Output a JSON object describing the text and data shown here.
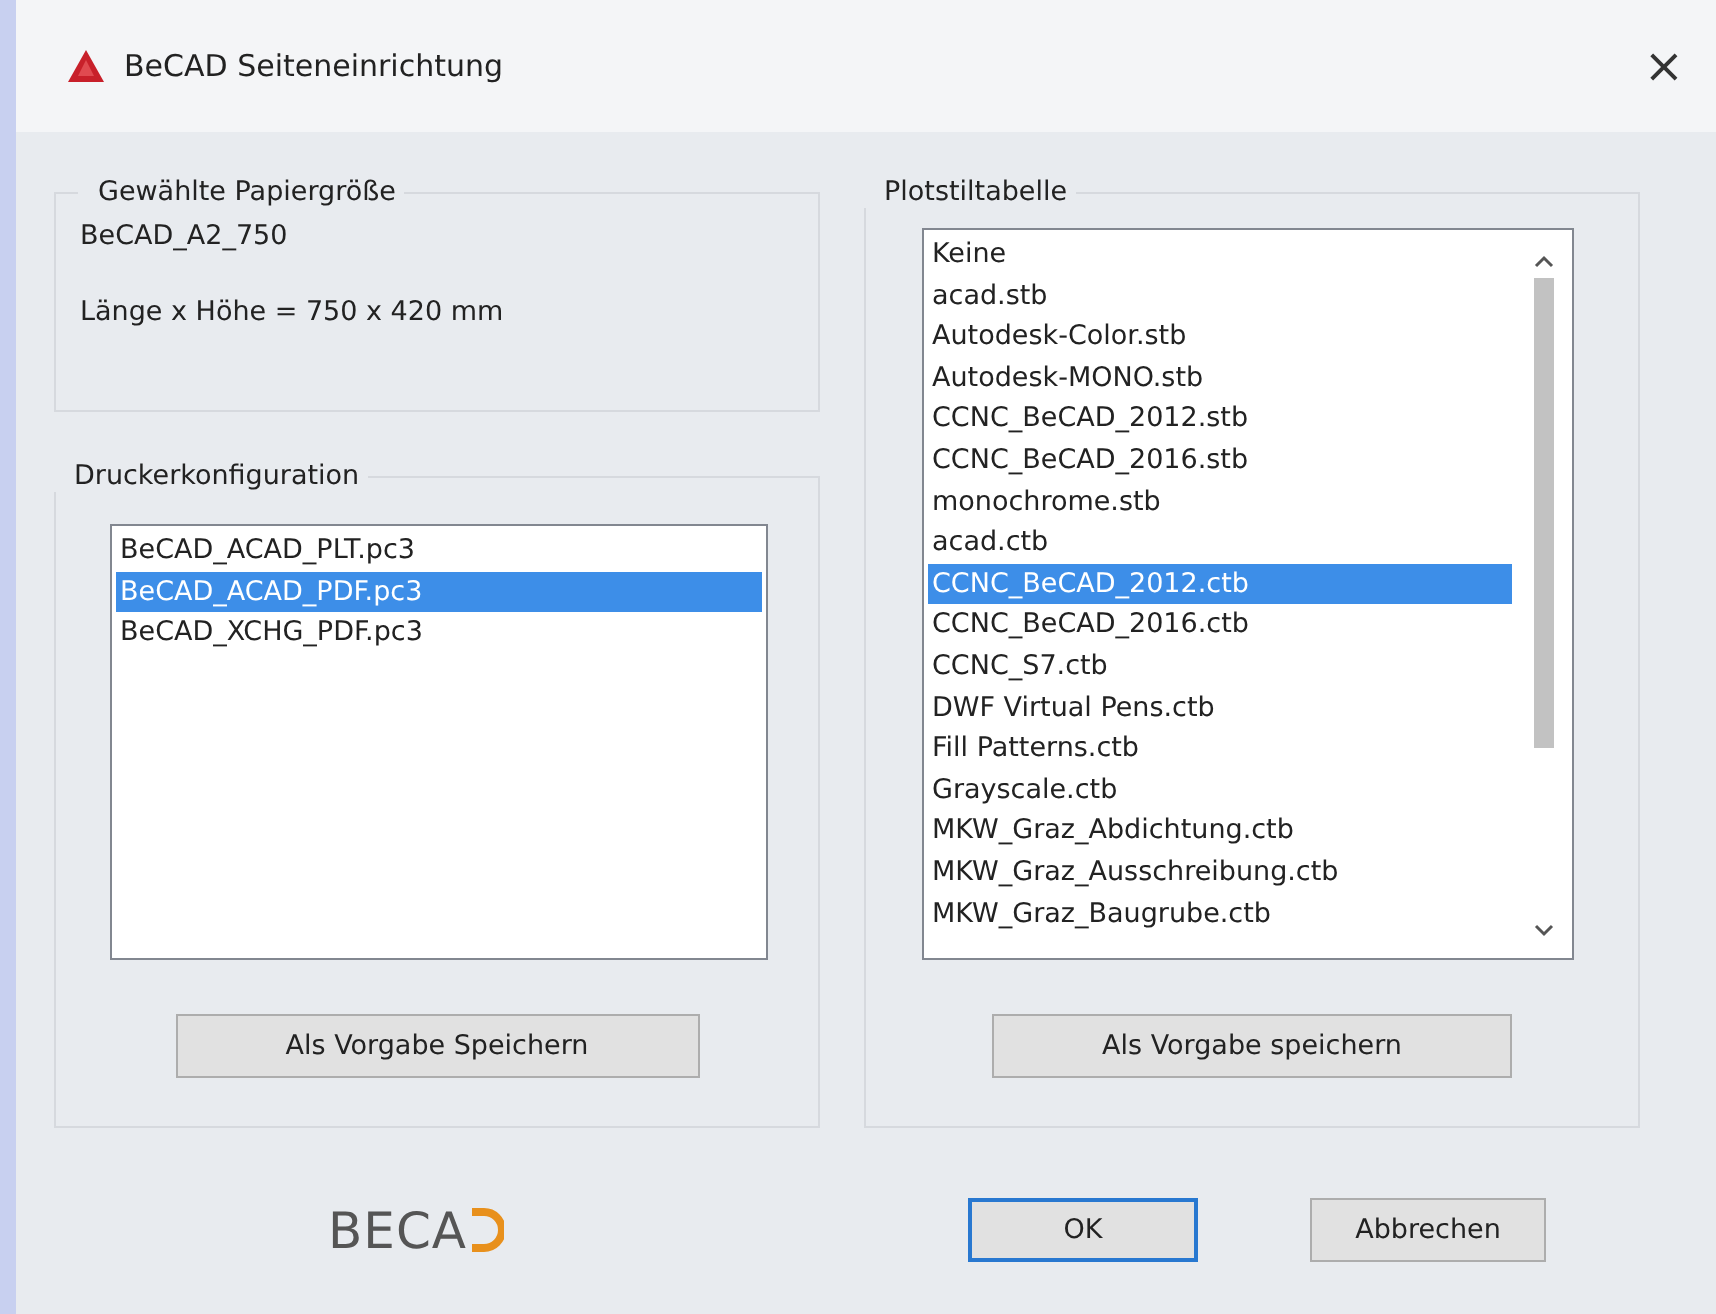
{
  "window": {
    "title": "BeCAD Seiteneinrichtung",
    "close": "×"
  },
  "paper": {
    "title": "Gewählte Papiergröße",
    "name": "BeCAD_A2_750",
    "size": "Länge x Höhe = 750 x 420 mm"
  },
  "printer": {
    "title": "Druckerkonfiguration",
    "items": [
      {
        "label": "BeCAD_ACAD_PLT.pc3",
        "selected": false
      },
      {
        "label": "BeCAD_ACAD_PDF.pc3",
        "selected": true
      },
      {
        "label": "BeCAD_XCHG_PDF.pc3",
        "selected": false
      }
    ],
    "button": "Als Vorgabe Speichern"
  },
  "plotstyle": {
    "title": "Plotstiltabelle",
    "items": [
      {
        "label": "Keine",
        "selected": false
      },
      {
        "label": "acad.stb",
        "selected": false
      },
      {
        "label": "Autodesk-Color.stb",
        "selected": false
      },
      {
        "label": "Autodesk-MONO.stb",
        "selected": false
      },
      {
        "label": "CCNC_BeCAD_2012.stb",
        "selected": false
      },
      {
        "label": "CCNC_BeCAD_2016.stb",
        "selected": false
      },
      {
        "label": "monochrome.stb",
        "selected": false
      },
      {
        "label": "acad.ctb",
        "selected": false
      },
      {
        "label": "CCNC_BeCAD_2012.ctb",
        "selected": true
      },
      {
        "label": "CCNC_BeCAD_2016.ctb",
        "selected": false
      },
      {
        "label": "CCNC_S7.ctb",
        "selected": false
      },
      {
        "label": "DWF Virtual Pens.ctb",
        "selected": false
      },
      {
        "label": "Fill Patterns.ctb",
        "selected": false
      },
      {
        "label": "Grayscale.ctb",
        "selected": false
      },
      {
        "label": "MKW_Graz_Abdichtung.ctb",
        "selected": false
      },
      {
        "label": "MKW_Graz_Ausschreibung.ctb",
        "selected": false
      },
      {
        "label": "MKW_Graz_Baugrube.ctb",
        "selected": false
      }
    ],
    "button": "Als Vorgabe speichern"
  },
  "footer": {
    "logo": "BECA",
    "ok": "OK",
    "cancel": "Abbrechen"
  }
}
